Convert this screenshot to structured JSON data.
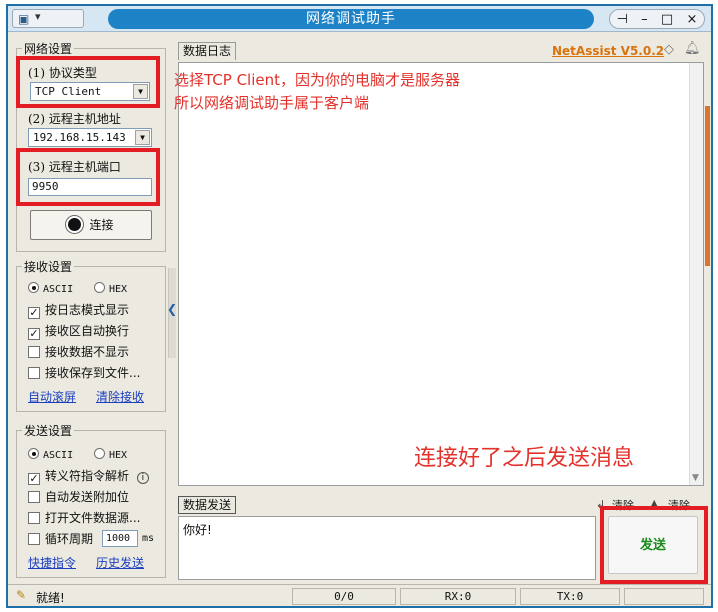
{
  "window": {
    "title": "网络调试助手",
    "controls": {
      "pin": "⊣",
      "minimize": "–",
      "maximize": "□",
      "close": "×"
    }
  },
  "network_settings": {
    "title": "网络设置",
    "protocol_label": "(1) 协议类型",
    "protocol_value": "TCP Client",
    "remote_host_label": "(2) 远程主机地址",
    "remote_host_value": "192.168.15.143",
    "remote_port_label": "(3) 远程主机端口",
    "remote_port_value": "9950",
    "connect_label": "连接"
  },
  "receive_settings": {
    "title": "接收设置",
    "ascii_label": "ASCII",
    "hex_label": "HEX",
    "encoding_selected": "ASCII",
    "options": [
      {
        "label": "按日志模式显示",
        "checked": true
      },
      {
        "label": "接收区自动换行",
        "checked": true
      },
      {
        "label": "接收数据不显示",
        "checked": false
      },
      {
        "label": "接收保存到文件...",
        "checked": false
      }
    ],
    "auto_scroll_link": "自动滚屏",
    "clear_receive_link": "清除接收"
  },
  "send_settings": {
    "title": "发送设置",
    "ascii_label": "ASCII",
    "hex_label": "HEX",
    "encoding_selected": "ASCII",
    "options": [
      {
        "label": "转义符指令解析",
        "checked": true
      },
      {
        "label": "自动发送附加位",
        "checked": false
      },
      {
        "label": "打开文件数据源...",
        "checked": false
      }
    ],
    "cycle_label": "循环周期",
    "cycle_checked": false,
    "cycle_value": "1000",
    "cycle_unit": "ms",
    "shortcut_link": "快捷指令",
    "history_link": "历史发送"
  },
  "data_log": {
    "tab_label": "数据日志",
    "brand": "NetAssist V5.0.2"
  },
  "annotations": {
    "line1": "选择TCP Client，因为你的电脑才是服务器",
    "line2": "所以网络调试助手属于客户端",
    "line3": "连接好了之后发送消息"
  },
  "send_area": {
    "tab_label": "数据发送",
    "clear_label": "清除",
    "clear2_label": "清除",
    "message": "你好!",
    "send_button": "发送"
  },
  "status_bar": {
    "status": "就绪!",
    "counter": "0/0",
    "rx": "RX:0",
    "tx": "TX:0"
  },
  "colors": {
    "title_bar": "#1e83c6",
    "annotation_red": "#e3312b",
    "highlight_box": "#e31d23",
    "send_text_green": "#1a8a1a",
    "brand_orange": "#d9730d"
  }
}
